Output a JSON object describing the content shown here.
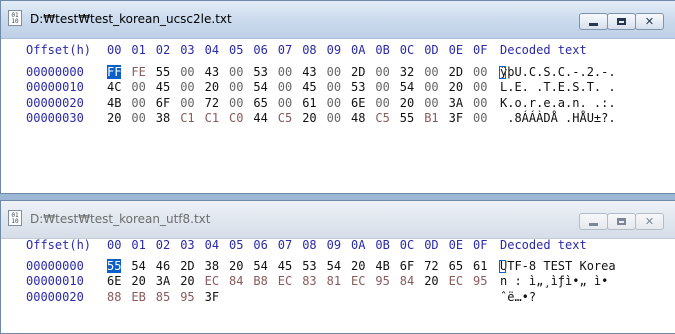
{
  "windows": [
    {
      "title": "D:₩test₩test_korean_ucsc2le.txt",
      "icon_name": "hex-file-icon",
      "header": {
        "offset_label": "Offset(h)",
        "columns": [
          "00",
          "01",
          "02",
          "03",
          "04",
          "05",
          "06",
          "07",
          "08",
          "09",
          "0A",
          "0B",
          "0C",
          "0D",
          "0E",
          "0F"
        ],
        "decoded_label": "Decoded text"
      },
      "rows": [
        {
          "offset": "00000000",
          "bytes": [
            "FF",
            "FE",
            "55",
            "00",
            "43",
            "00",
            "53",
            "00",
            "43",
            "00",
            "2D",
            "00",
            "32",
            "00",
            "2D",
            "00"
          ],
          "decoded": "ÿþU.C.S.C.-.2.-."
        },
        {
          "offset": "00000010",
          "bytes": [
            "4C",
            "00",
            "45",
            "00",
            "20",
            "00",
            "54",
            "00",
            "45",
            "00",
            "53",
            "00",
            "54",
            "00",
            "20",
            "00"
          ],
          "decoded": "L.E. .T.E.S.T. ."
        },
        {
          "offset": "00000020",
          "bytes": [
            "4B",
            "00",
            "6F",
            "00",
            "72",
            "00",
            "65",
            "00",
            "61",
            "00",
            "6E",
            "00",
            "20",
            "00",
            "3A",
            "00"
          ],
          "decoded": "K.o.r.e.a.n. .:."
        },
        {
          "offset": "00000030",
          "bytes": [
            "20",
            "00",
            "38",
            "C1",
            "C1",
            "C0",
            "44",
            "C5",
            "20",
            "00",
            "48",
            "C5",
            "55",
            "B1",
            "3F",
            "00"
          ],
          "decoded": " .8ÁÁÀDÅ .HÅU±?."
        }
      ]
    },
    {
      "title": "D:₩test₩test_korean_utf8.txt",
      "icon_name": "hex-file-icon",
      "header": {
        "offset_label": "Offset(h)",
        "columns": [
          "00",
          "01",
          "02",
          "03",
          "04",
          "05",
          "06",
          "07",
          "08",
          "09",
          "0A",
          "0B",
          "0C",
          "0D",
          "0E",
          "0F"
        ],
        "decoded_label": "Decoded text"
      },
      "rows": [
        {
          "offset": "00000000",
          "bytes": [
            "55",
            "54",
            "46",
            "2D",
            "38",
            "20",
            "54",
            "45",
            "53",
            "54",
            "20",
            "4B",
            "6F",
            "72",
            "65",
            "61"
          ],
          "decoded": "UTF-8 TEST Korea"
        },
        {
          "offset": "00000010",
          "bytes": [
            "6E",
            "20",
            "3A",
            "20",
            "EC",
            "84",
            "B8",
            "EC",
            "83",
            "81",
            "EC",
            "95",
            "84",
            "20",
            "EC",
            "95"
          ],
          "decoded": "n : ì„¸ìƒì•„ ì•"
        },
        {
          "offset": "00000020",
          "bytes": [
            "88",
            "EB",
            "85",
            "95",
            "3F"
          ],
          "decoded": "ˆë…•?"
        }
      ]
    }
  ],
  "controls": {
    "minimize_icon": "minimize-icon",
    "maximize_icon": "maximize-icon",
    "close_icon": "close-icon",
    "close_glyph": "✕"
  },
  "colors": {
    "header_text": "#2a2aa8",
    "selection": "#0a60c8"
  }
}
